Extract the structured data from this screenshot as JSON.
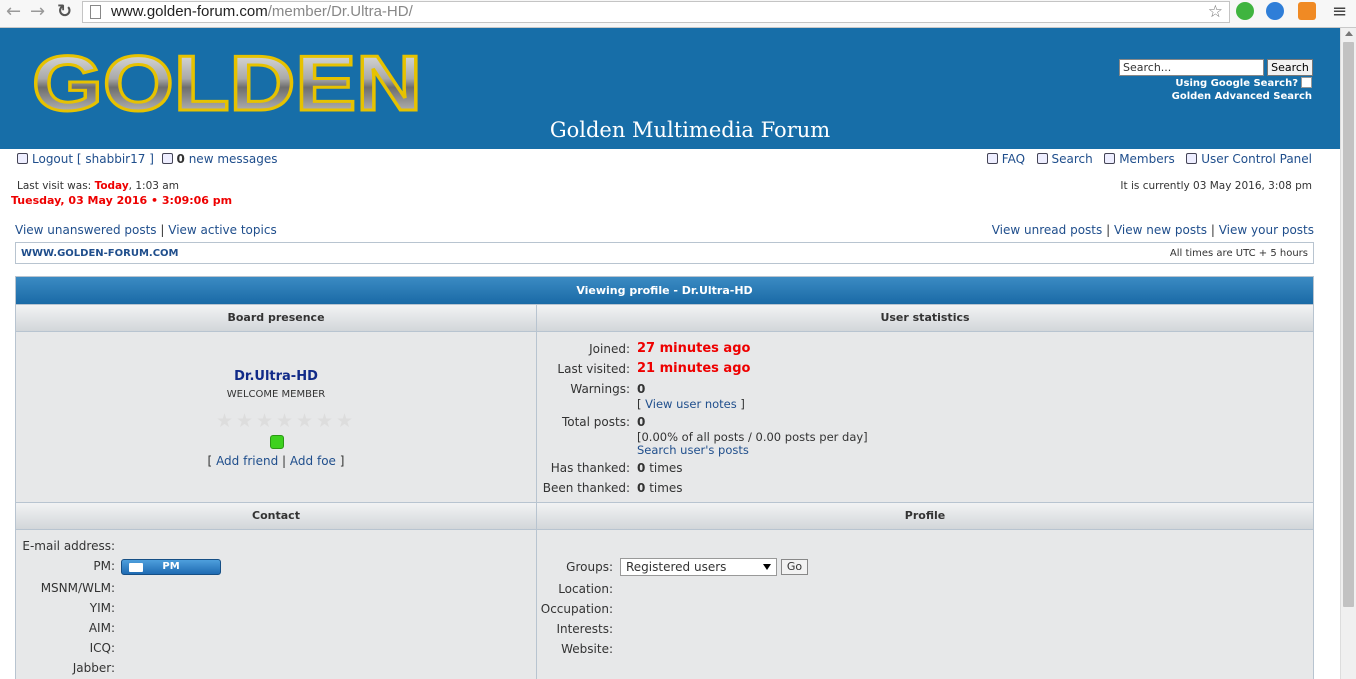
{
  "browser": {
    "url_host": "www.golden-forum.com",
    "url_path": "/member/Dr.Ultra-HD/"
  },
  "header": {
    "logo_text": "GOLDEN",
    "forum_title": "Golden Multimedia Forum",
    "search_placeholder": "Search...",
    "search_button": "Search",
    "google_search_label": "Using Google Search?",
    "advanced_search": "Golden Advanced Search"
  },
  "topnav": {
    "logout": "Logout [ shabbir17 ]",
    "new_messages_count": "0",
    "new_messages_label": "new messages",
    "faq": "FAQ",
    "search": "Search",
    "members": "Members",
    "ucp": "User Control Panel"
  },
  "visit": {
    "last_visit_label": "Last visit was:",
    "last_visit_today": "Today",
    "last_visit_time": ", 1:03 am",
    "clock": "Tuesday, 03 May 2016 • 3:09:06 pm",
    "current_time": "It is currently 03 May 2016, 3:08 pm"
  },
  "links": {
    "unanswered": "View unanswered posts",
    "active": "View active topics",
    "unread": "View unread posts",
    "new_posts": "View new posts",
    "your_posts": "View your posts",
    "sep": "|"
  },
  "breadcrumb": {
    "site": "WWW.GOLDEN-FORUM.COM",
    "timezone": "All times are UTC + 5 hours"
  },
  "profile": {
    "title": "Viewing profile - Dr.Ultra-HD",
    "board_presence_header": "Board presence",
    "user_stats_header": "User statistics",
    "username": "Dr.Ultra-HD",
    "rank": "WELCOME MEMBER",
    "star_rating": 0,
    "star_max": 7,
    "friend_links": {
      "open": "[",
      "add_friend": "Add friend",
      "sep": "|",
      "add_foe": "Add foe",
      "close": "]"
    },
    "stats": {
      "joined_label": "Joined:",
      "joined_value": "27 minutes ago",
      "last_visited_label": "Last visited:",
      "last_visited_value": "21 minutes ago",
      "warnings_label": "Warnings:",
      "warnings_value": "0",
      "view_notes_open": "[",
      "view_notes": "View user notes",
      "view_notes_close": "]",
      "total_posts_label": "Total posts:",
      "total_posts_value": "0",
      "posts_detail": "[0.00% of all posts / 0.00 posts per day]",
      "search_posts": "Search user's posts",
      "has_thanked_label": "Has thanked:",
      "has_thanked_count": "0",
      "has_thanked_unit": "times",
      "been_thanked_label": "Been thanked:",
      "been_thanked_count": "0",
      "been_thanked_unit": "times"
    },
    "contact_header": "Contact",
    "profile_header": "Profile",
    "contact": {
      "email": "E-mail address:",
      "pm": "PM:",
      "pm_button": "PM",
      "msnm": "MSNM/WLM:",
      "yim": "YIM:",
      "aim": "AIM:",
      "icq": "ICQ:",
      "jabber": "Jabber:"
    },
    "profile_fields": {
      "groups": "Groups:",
      "groups_selected": "Registered users",
      "go": "Go",
      "location": "Location:",
      "occupation": "Occupation:",
      "interests": "Interests:",
      "website": "Website:"
    }
  },
  "colors": {
    "header_blue": "#176ea8",
    "link_blue": "#1f4e8c",
    "alert_red": "#e00000",
    "online_green": "#3dd11e"
  }
}
